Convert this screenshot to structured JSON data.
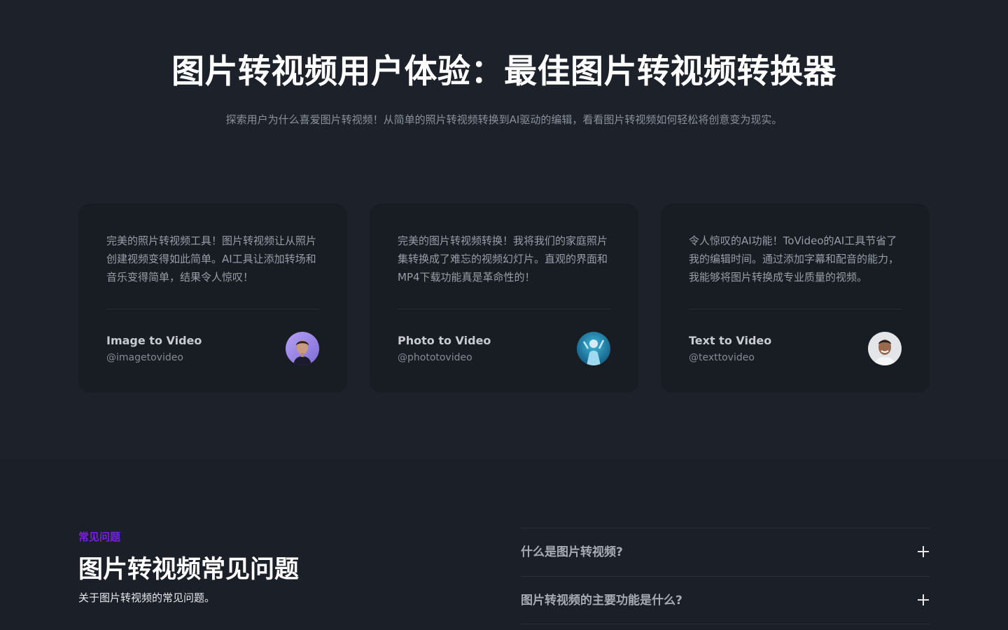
{
  "hero": {
    "title": "图片转视频用户体验：最佳图片转视频转换器",
    "subtitle": "探索用户为什么喜爱图片转视频！从简单的照片转视频转换到AI驱动的编辑，看看图片转视频如何轻松将创意变为现实。"
  },
  "testimonials": [
    {
      "quote": "完美的照片转视频工具！图片转视频让从照片创建视频变得如此简单。AI工具让添加转场和音乐变得简单，结果令人惊叹！",
      "name": "Image to Video",
      "handle": "@imagetovideo",
      "avatar_icon": "woman-portrait-avatar"
    },
    {
      "quote": "完美的图片转视频转换！我将我们的家庭照片集转换成了难忘的视频幻灯片。直观的界面和MP4下载功能真是革命性的！",
      "name": "Photo to Video",
      "handle": "@phototovideo",
      "avatar_icon": "figure-blue-avatar"
    },
    {
      "quote": "令人惊叹的AI功能！ToVideo的AI工具节省了我的编辑时间。通过添加字幕和配音的能力，我能够将图片转换成专业质量的视频。",
      "name": "Text to Video",
      "handle": "@texttovideo",
      "avatar_icon": "man-smiling-avatar"
    }
  ],
  "faq": {
    "eyebrow": "常见问题",
    "title": "图片转视频常见问题",
    "description": "关于图片转视频的常见问题。",
    "items": [
      {
        "question": "什么是图片转视频?"
      },
      {
        "question": "图片转视频的主要功能是什么?"
      }
    ]
  },
  "colors": {
    "background": "#1c212a",
    "card": "#181c23",
    "accent": "#7b1fe3"
  }
}
